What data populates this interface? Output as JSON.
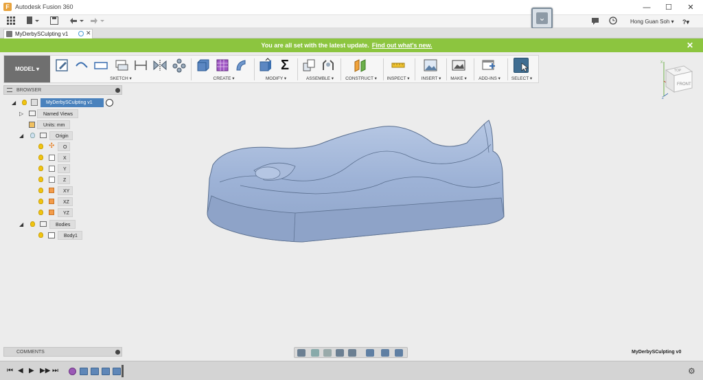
{
  "app": {
    "title": "Autodesk Fusion 360",
    "icon_letter": "F"
  },
  "window": {
    "minimize": "—",
    "maximize": "☐",
    "close": "✕"
  },
  "quick_access": {
    "icons": [
      "grid-icon",
      "file-icon",
      "save-icon",
      "undo-icon",
      "redo-icon"
    ]
  },
  "user": {
    "name": "Hong Guan Soh ▾",
    "help": "?▾"
  },
  "document": {
    "tab_label": "MyDerbySCulpting v1",
    "tab_close": "✕",
    "name_label": "MyDerbySCulpting v0"
  },
  "banner": {
    "message": "You are all set with the latest update.",
    "link": "Find out what's new.",
    "close": "✕"
  },
  "ribbon": {
    "workspace": "MODEL ▾",
    "groups": [
      "SKETCH ▾",
      "CREATE ▾",
      "MODIFY ▾",
      "ASSEMBLE ▾",
      "CONSTRUCT ▾",
      "INSPECT ▾",
      "INSERT ▾",
      "MAKE ▾",
      "ADD-INS ▾",
      "SELECT ▾"
    ],
    "sigma": "Σ"
  },
  "browser": {
    "title": "BROWSER",
    "root": "MyDerbySCulpting v1",
    "named_views": "Named Views",
    "units": "Units: mm",
    "origin": "Origin",
    "origin_items": [
      "O",
      "X",
      "Y",
      "Z",
      "XY",
      "XZ",
      "YZ"
    ],
    "bodies": "Bodies",
    "body": "Body1"
  },
  "comments": {
    "title": "COMMENTS"
  },
  "viewcube": {
    "top": "TOP",
    "front": "FRONT",
    "x": "X",
    "z": "Z"
  },
  "timeline": {
    "controls": [
      "⏮",
      "◀",
      "▶",
      "▶▶",
      "⏭"
    ]
  },
  "colors": {
    "banner": "#8cc53f",
    "model_body": "#9fb4d6",
    "accent": "#4a9ad0"
  }
}
